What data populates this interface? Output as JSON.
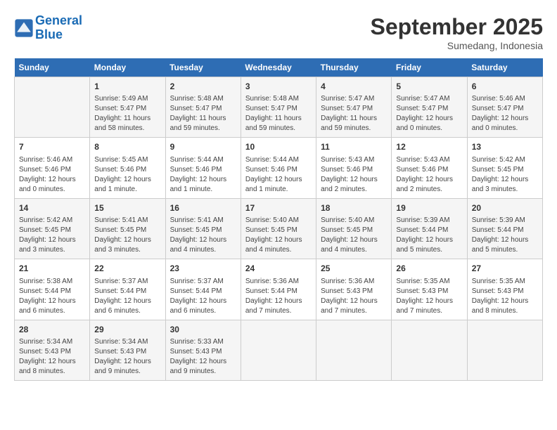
{
  "header": {
    "logo_line1": "General",
    "logo_line2": "Blue",
    "month": "September 2025",
    "location": "Sumedang, Indonesia"
  },
  "days_of_week": [
    "Sunday",
    "Monday",
    "Tuesday",
    "Wednesday",
    "Thursday",
    "Friday",
    "Saturday"
  ],
  "weeks": [
    [
      {
        "day": "",
        "info": ""
      },
      {
        "day": "1",
        "info": "Sunrise: 5:49 AM\nSunset: 5:47 PM\nDaylight: 11 hours\nand 58 minutes."
      },
      {
        "day": "2",
        "info": "Sunrise: 5:48 AM\nSunset: 5:47 PM\nDaylight: 11 hours\nand 59 minutes."
      },
      {
        "day": "3",
        "info": "Sunrise: 5:48 AM\nSunset: 5:47 PM\nDaylight: 11 hours\nand 59 minutes."
      },
      {
        "day": "4",
        "info": "Sunrise: 5:47 AM\nSunset: 5:47 PM\nDaylight: 11 hours\nand 59 minutes."
      },
      {
        "day": "5",
        "info": "Sunrise: 5:47 AM\nSunset: 5:47 PM\nDaylight: 12 hours\nand 0 minutes."
      },
      {
        "day": "6",
        "info": "Sunrise: 5:46 AM\nSunset: 5:47 PM\nDaylight: 12 hours\nand 0 minutes."
      }
    ],
    [
      {
        "day": "7",
        "info": "Sunrise: 5:46 AM\nSunset: 5:46 PM\nDaylight: 12 hours\nand 0 minutes."
      },
      {
        "day": "8",
        "info": "Sunrise: 5:45 AM\nSunset: 5:46 PM\nDaylight: 12 hours\nand 1 minute."
      },
      {
        "day": "9",
        "info": "Sunrise: 5:44 AM\nSunset: 5:46 PM\nDaylight: 12 hours\nand 1 minute."
      },
      {
        "day": "10",
        "info": "Sunrise: 5:44 AM\nSunset: 5:46 PM\nDaylight: 12 hours\nand 1 minute."
      },
      {
        "day": "11",
        "info": "Sunrise: 5:43 AM\nSunset: 5:46 PM\nDaylight: 12 hours\nand 2 minutes."
      },
      {
        "day": "12",
        "info": "Sunrise: 5:43 AM\nSunset: 5:46 PM\nDaylight: 12 hours\nand 2 minutes."
      },
      {
        "day": "13",
        "info": "Sunrise: 5:42 AM\nSunset: 5:45 PM\nDaylight: 12 hours\nand 3 minutes."
      }
    ],
    [
      {
        "day": "14",
        "info": "Sunrise: 5:42 AM\nSunset: 5:45 PM\nDaylight: 12 hours\nand 3 minutes."
      },
      {
        "day": "15",
        "info": "Sunrise: 5:41 AM\nSunset: 5:45 PM\nDaylight: 12 hours\nand 3 minutes."
      },
      {
        "day": "16",
        "info": "Sunrise: 5:41 AM\nSunset: 5:45 PM\nDaylight: 12 hours\nand 4 minutes."
      },
      {
        "day": "17",
        "info": "Sunrise: 5:40 AM\nSunset: 5:45 PM\nDaylight: 12 hours\nand 4 minutes."
      },
      {
        "day": "18",
        "info": "Sunrise: 5:40 AM\nSunset: 5:45 PM\nDaylight: 12 hours\nand 4 minutes."
      },
      {
        "day": "19",
        "info": "Sunrise: 5:39 AM\nSunset: 5:44 PM\nDaylight: 12 hours\nand 5 minutes."
      },
      {
        "day": "20",
        "info": "Sunrise: 5:39 AM\nSunset: 5:44 PM\nDaylight: 12 hours\nand 5 minutes."
      }
    ],
    [
      {
        "day": "21",
        "info": "Sunrise: 5:38 AM\nSunset: 5:44 PM\nDaylight: 12 hours\nand 6 minutes."
      },
      {
        "day": "22",
        "info": "Sunrise: 5:37 AM\nSunset: 5:44 PM\nDaylight: 12 hours\nand 6 minutes."
      },
      {
        "day": "23",
        "info": "Sunrise: 5:37 AM\nSunset: 5:44 PM\nDaylight: 12 hours\nand 6 minutes."
      },
      {
        "day": "24",
        "info": "Sunrise: 5:36 AM\nSunset: 5:44 PM\nDaylight: 12 hours\nand 7 minutes."
      },
      {
        "day": "25",
        "info": "Sunrise: 5:36 AM\nSunset: 5:43 PM\nDaylight: 12 hours\nand 7 minutes."
      },
      {
        "day": "26",
        "info": "Sunrise: 5:35 AM\nSunset: 5:43 PM\nDaylight: 12 hours\nand 7 minutes."
      },
      {
        "day": "27",
        "info": "Sunrise: 5:35 AM\nSunset: 5:43 PM\nDaylight: 12 hours\nand 8 minutes."
      }
    ],
    [
      {
        "day": "28",
        "info": "Sunrise: 5:34 AM\nSunset: 5:43 PM\nDaylight: 12 hours\nand 8 minutes."
      },
      {
        "day": "29",
        "info": "Sunrise: 5:34 AM\nSunset: 5:43 PM\nDaylight: 12 hours\nand 9 minutes."
      },
      {
        "day": "30",
        "info": "Sunrise: 5:33 AM\nSunset: 5:43 PM\nDaylight: 12 hours\nand 9 minutes."
      },
      {
        "day": "",
        "info": ""
      },
      {
        "day": "",
        "info": ""
      },
      {
        "day": "",
        "info": ""
      },
      {
        "day": "",
        "info": ""
      }
    ]
  ]
}
